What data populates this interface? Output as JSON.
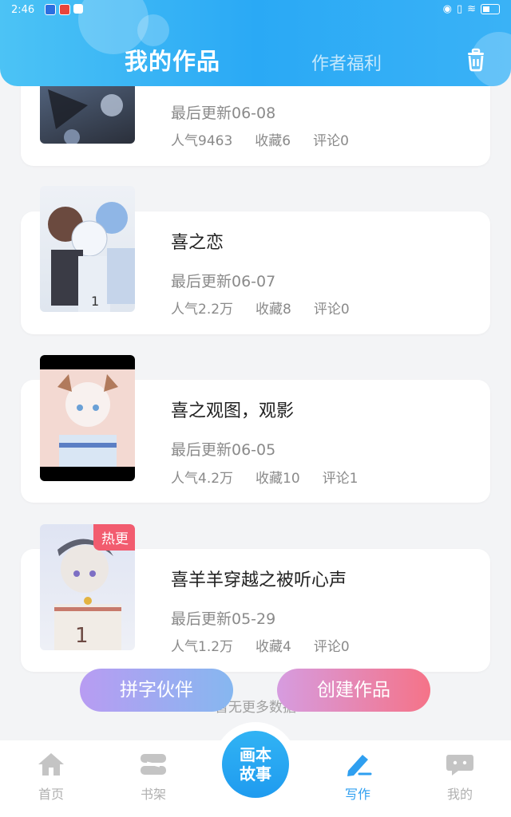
{
  "status": {
    "time": "2:46"
  },
  "header": {
    "tab_active": "我的作品",
    "tab_other": "作者福利"
  },
  "works": [
    {
      "title": "",
      "updated": "最后更新06-08",
      "popularity": "人气9463",
      "favorites": "收藏6",
      "comments": "评论0",
      "badge": ""
    },
    {
      "title": "喜之恋",
      "updated": "最后更新06-07",
      "popularity": "人气2.2万",
      "favorites": "收藏8",
      "comments": "评论0",
      "badge": ""
    },
    {
      "title": "喜之观图，观影",
      "updated": "最后更新06-05",
      "popularity": "人气4.2万",
      "favorites": "收藏10",
      "comments": "评论1",
      "badge": ""
    },
    {
      "title": "喜羊羊穿越之被听心声",
      "updated": "最后更新05-29",
      "popularity": "人气1.2万",
      "favorites": "收藏4",
      "comments": "评论0",
      "badge": "热更"
    }
  ],
  "list_end": "暂无更多数据",
  "actions": {
    "partner": "拼字伙伴",
    "create": "创建作品"
  },
  "nav": {
    "home": "首页",
    "shelf": "书架",
    "center_line1": "画本",
    "center_line2": "故事",
    "write": "写作",
    "mine": "我的"
  },
  "colors": {
    "accent": "#2aa9f5",
    "hot": "#f25c6f"
  }
}
